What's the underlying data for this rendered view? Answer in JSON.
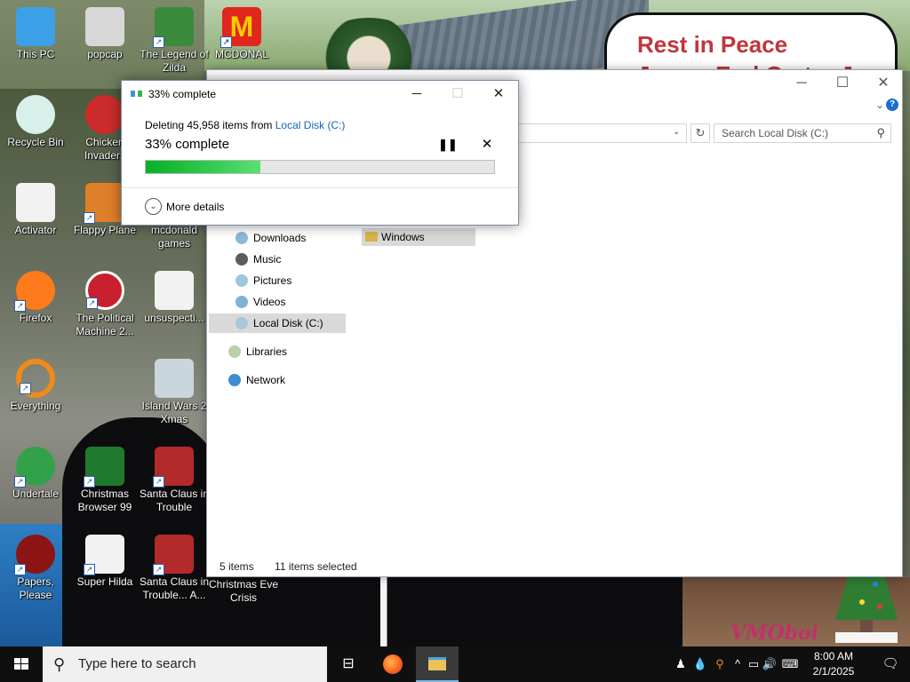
{
  "wallpaper": {
    "sign_line1": "Rest in Peace",
    "sign_line2": "James Earl Carter Jr.",
    "logo_text": "VMOboi"
  },
  "desktop_icons": [
    {
      "label": "This PC",
      "icon": "computer-icon",
      "color": "#3ba0e6"
    },
    {
      "label": "popcap",
      "icon": "popcap-icon",
      "color": "#d7d7d7"
    },
    {
      "label": "The Legend of Zilda",
      "icon": "game-icon",
      "color": "#3c8a3c"
    },
    {
      "label": "MCDONAL",
      "icon": "mcdonalds-icon",
      "color": "#e0261d"
    },
    {
      "label": "Recycle Bin",
      "icon": "recycle-bin-icon",
      "color": "#d8f0ea"
    },
    {
      "label": "Chicken Invaders",
      "icon": "chicken-icon",
      "color": "#cc2b2b"
    },
    {
      "label": "Activator",
      "icon": "file-icon",
      "color": "#f2f2f2"
    },
    {
      "label": "Flappy Plane",
      "icon": "plane-icon",
      "color": "#e07f2a"
    },
    {
      "label": "mcdonald games",
      "icon": "folder-icon",
      "color": "#e3c058"
    },
    {
      "label": "Firefox",
      "icon": "firefox-icon",
      "color": "#ff7a1a"
    },
    {
      "label": "The Political Machine 2...",
      "icon": "political-icon",
      "color": "#c8202f"
    },
    {
      "label": "unsuspecti...",
      "icon": "file-icon",
      "color": "#f2f2f2"
    },
    {
      "label": "Everything",
      "icon": "magnifier-icon",
      "color": "#f08a1a"
    },
    {
      "label": "Island Wars 2 Xmas",
      "icon": "island-icon",
      "color": "#c9d6dc"
    },
    {
      "label": "Undertale",
      "icon": "undertale-icon",
      "color": "#33a14a"
    },
    {
      "label": "Christmas Browser 99",
      "icon": "tree-icon",
      "color": "#1f7a2e"
    },
    {
      "label": "Santa Claus in Trouble",
      "icon": "santa-icon",
      "color": "#b32a2a"
    },
    {
      "label": "Papers, Please",
      "icon": "papers-icon",
      "color": "#8c1414"
    },
    {
      "label": "Super Hilda",
      "icon": "hilda-icon",
      "color": "#f2f2f2"
    },
    {
      "label": "Santa Claus in Trouble... A...",
      "icon": "santa-icon",
      "color": "#b32a2a"
    },
    {
      "label": "Christmas Eve Crisis",
      "icon": "crisis-icon",
      "color": "#2a2a2a"
    }
  ],
  "explorer": {
    "search_placeholder": "Search Local Disk (C:)",
    "nav": [
      {
        "label": "Downloads",
        "icon": "downloads-icon"
      },
      {
        "label": "Music",
        "icon": "music-icon"
      },
      {
        "label": "Pictures",
        "icon": "pictures-icon"
      },
      {
        "label": "Videos",
        "icon": "videos-icon"
      },
      {
        "label": "Local Disk (C:)",
        "icon": "disk-icon",
        "selected": true
      },
      {
        "label": "Libraries",
        "icon": "libraries-icon"
      },
      {
        "label": "Network",
        "icon": "network-icon"
      }
    ],
    "selected_folder": "Windows",
    "status_items": "5 items",
    "status_selected": "11 items selected"
  },
  "dialog": {
    "title": "33% complete",
    "line_prefix": "Deleting 45,958 items from ",
    "line_link": "Local Disk (C:)",
    "percent_text": "33% complete",
    "progress": 0.33,
    "more_details": "More details",
    "accent": "#06b025"
  },
  "taskbar": {
    "search_placeholder": "Type here to search",
    "time": "8:00 AM",
    "date": "2/1/2025"
  }
}
